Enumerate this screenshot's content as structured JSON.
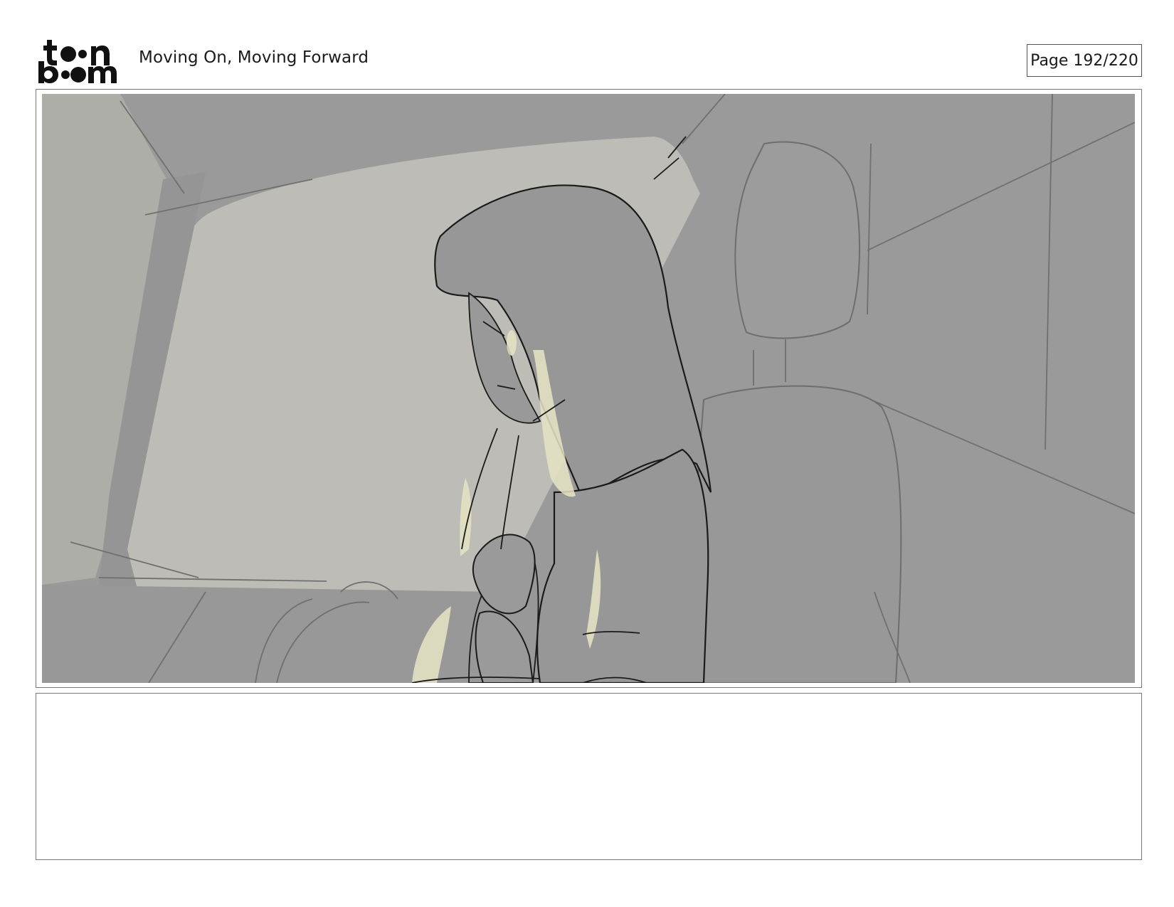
{
  "header": {
    "logo_text": "toon boom",
    "project_title": "Moving On, Moving Forward",
    "page_label": "Page 192/220"
  },
  "panel": {
    "image_icon": "storyboard-panel-sketch",
    "colors": {
      "background_gray": "#9a9a9a",
      "window_light": "#bdbcb6",
      "highlight_yellow": "#e6e4c4",
      "line_dark": "#1a1a1a"
    }
  },
  "caption": {
    "text": ""
  }
}
